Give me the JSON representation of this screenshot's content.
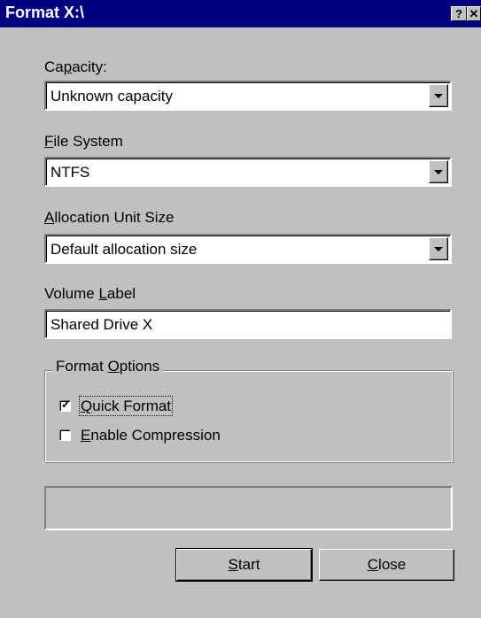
{
  "window": {
    "title": "Format X:\\",
    "help_label": "?",
    "close_label": "✕"
  },
  "capacity": {
    "label_pre": "Ca",
    "label_key": "p",
    "label_post": "acity:",
    "value": "Unknown capacity"
  },
  "file_system": {
    "label_key": "F",
    "label_post": "ile System",
    "value": "NTFS"
  },
  "allocation": {
    "label_key": "A",
    "label_post": "llocation Unit Size",
    "value": "Default allocation size"
  },
  "volume_label": {
    "label_pre": "Volume ",
    "label_key": "L",
    "label_post": "abel",
    "value": "Shared Drive X"
  },
  "format_options": {
    "label_pre": "Format ",
    "label_key": "O",
    "label_post": "ptions",
    "quick_format": {
      "label_key": "Q",
      "label_post": "uick Format",
      "checked": true,
      "mark": "✓"
    },
    "compression": {
      "label_key": "E",
      "label_post": "nable Compression",
      "checked": false
    }
  },
  "buttons": {
    "start_key": "S",
    "start_post": "tart",
    "close_key": "C",
    "close_post": "lose"
  }
}
